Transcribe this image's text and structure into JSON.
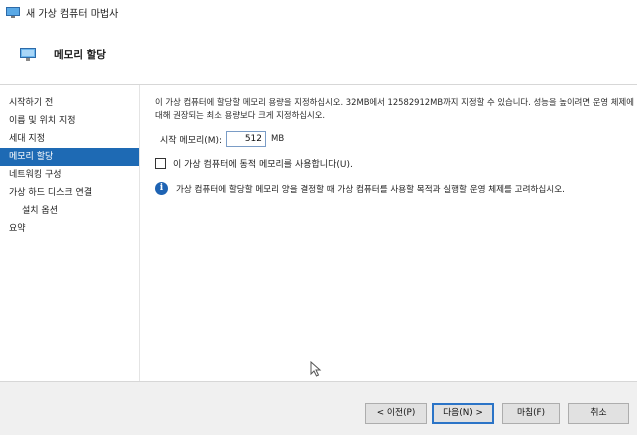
{
  "window": {
    "title": "새 가상 컴퓨터 마법사",
    "app_icon": "computer-monitor-icon"
  },
  "header": {
    "title": "메모리 할당",
    "icon": "memory-page-icon"
  },
  "sidebar": {
    "items": [
      {
        "label": "시작하기 전",
        "active": false,
        "sub": false
      },
      {
        "label": "이름 및 위치 지정",
        "active": false,
        "sub": false
      },
      {
        "label": "세대 지정",
        "active": false,
        "sub": false
      },
      {
        "label": "메모리 할당",
        "active": true,
        "sub": false
      },
      {
        "label": "네트워킹 구성",
        "active": false,
        "sub": false
      },
      {
        "label": "가상 하드 디스크 연결",
        "active": false,
        "sub": false
      },
      {
        "label": "설치 옵션",
        "active": false,
        "sub": true
      },
      {
        "label": "요약",
        "active": false,
        "sub": false
      }
    ],
    "active_color": "#1e6ab4"
  },
  "main": {
    "description": "이 가상 컴퓨터에 할당할 메모리 용량을 지정하십시오. 32MB에서 12582912MB까지 지정할 수 있습니다. 성능을 높이려면 운영 체제에 대해 권장되는 최소 용량보다 크게 지정하십시오.",
    "startup_memory_label": "시작 메모리(M):",
    "startup_memory_value": "512",
    "startup_memory_unit": "MB",
    "dynamic_memory_label": "이 가상 컴퓨터에 동적 메모리를 사용합니다(U).",
    "dynamic_memory_checked": false,
    "info_icon": "info-icon",
    "info_text": "가상 컴퓨터에 할당할 메모리 양을 결정할 때 가상 컴퓨터를 사용할 목적과 실행할 운영 체제를 고려하십시오."
  },
  "footer": {
    "prev_label": "< 이전(P)",
    "next_label": "다음(N) >",
    "finish_label": "마침(F)",
    "cancel_label": "취소"
  },
  "colors": {
    "accent": "#1e6ab4",
    "info": "#1e63b3",
    "footer_bg": "#f0f0f0"
  }
}
